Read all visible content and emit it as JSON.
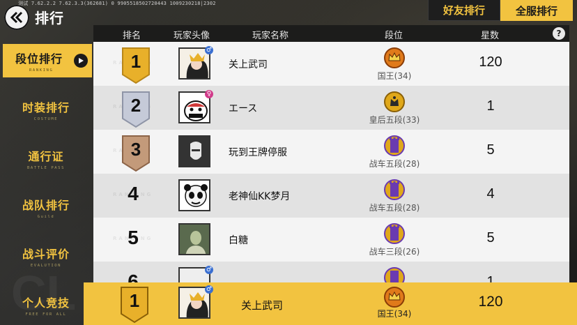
{
  "header": {
    "version_text": "测试 7.62.2.2 7.62.3.3(362681) 0 9905518502720443 1009230218|2302",
    "title": "排行",
    "tab_friends": "好友排行",
    "tab_server": "全服排行"
  },
  "sidebar": {
    "items": [
      {
        "label": "段位排行",
        "sub": "RANKING"
      },
      {
        "label": "时装排行",
        "sub": "COSTUME"
      },
      {
        "label": "通行证",
        "sub": "BATTLE PASS"
      },
      {
        "label": "战队排行",
        "sub": "Guild"
      },
      {
        "label": "战斗评价",
        "sub": "EVALUTION"
      },
      {
        "label": "个人竞技",
        "sub": "FREE FOR ALL"
      }
    ]
  },
  "table": {
    "columns": [
      "排名",
      "玩家头像",
      "玩家名称",
      "段位",
      "星数"
    ],
    "watermark": "RANKING",
    "rows": [
      {
        "rank": "1",
        "name": "关上武司",
        "tier": "国王(34)",
        "stars": "120",
        "tier_color": "#e07a1a",
        "gender": "♂",
        "gender_color": "#3a6fd1"
      },
      {
        "rank": "2",
        "name": "エース",
        "tier": "皇后五段(33)",
        "stars": "1",
        "tier_color": "#e0a81a",
        "gender": "♀",
        "gender_color": "#d13a8a"
      },
      {
        "rank": "3",
        "name": "玩到王牌停服",
        "tier": "战车五段(28)",
        "stars": "5",
        "tier_color": "#6a3ab0",
        "gender": "",
        "gender_color": ""
      },
      {
        "rank": "4",
        "name": "老神仙KK梦月",
        "tier": "战车五段(28)",
        "stars": "4",
        "tier_color": "#6a3ab0",
        "gender": "",
        "gender_color": ""
      },
      {
        "rank": "5",
        "name": "白糖",
        "tier": "战车三段(26)",
        "stars": "5",
        "tier_color": "#6a3ab0",
        "gender": "",
        "gender_color": ""
      },
      {
        "rank": "6",
        "name": "",
        "tier": "",
        "stars": "1",
        "tier_color": "#6a3ab0",
        "gender": "♂",
        "gender_color": "#3a6fd1"
      }
    ]
  },
  "my_rank": {
    "rank": "1",
    "name": "关上武司",
    "tier": "国王(34)",
    "stars": "120",
    "gender": "♂"
  },
  "colors": {
    "accent": "#f2c340",
    "dark": "#1c1c1b"
  }
}
